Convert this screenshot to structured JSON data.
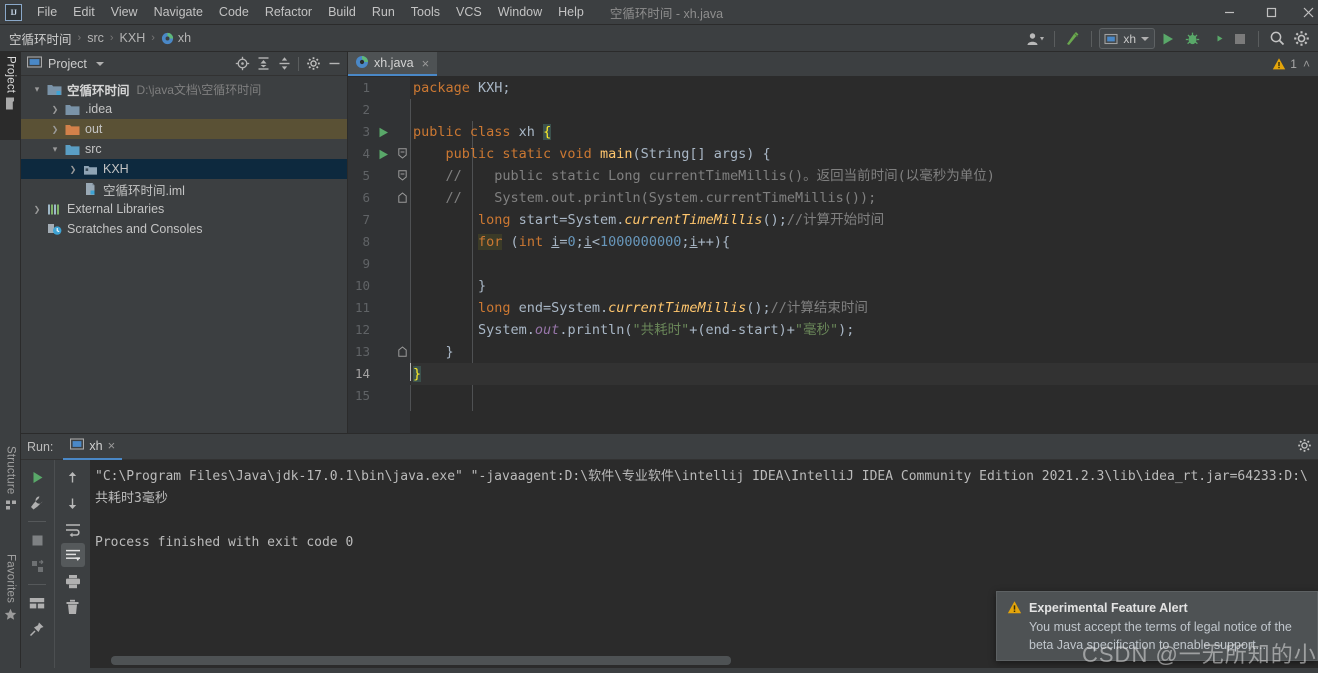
{
  "window": {
    "title": "空循环时间 - xh.java",
    "logo_text": "IJ",
    "controls": {
      "minimize": "minimize-icon",
      "maximize": "maximize-icon",
      "close": "close-icon"
    }
  },
  "menubar": {
    "items": [
      "File",
      "Edit",
      "View",
      "Navigate",
      "Code",
      "Refactor",
      "Build",
      "Run",
      "Tools",
      "VCS",
      "Window",
      "Help"
    ]
  },
  "navbar": {
    "breadcrumbs": [
      "空循环时间",
      "src",
      "KXH",
      "xh"
    ],
    "separator": "›",
    "toolbar": {
      "user_icon": "user-avatar-icon",
      "build_icon": "build-hammer-icon",
      "run_config": "xh",
      "run_icon": "run-play-icon",
      "debug_icon": "debug-bug-icon",
      "coverage_icon": "run-with-coverage-icon",
      "stop_icon": "stop-square-icon",
      "search_icon": "search-icon",
      "settings_icon": "gear-icon"
    }
  },
  "tool_tabs": {
    "left_top": "Project",
    "left_bottom": [
      "Structure",
      "Favorites"
    ]
  },
  "project_panel": {
    "title": "Project",
    "header_icons": [
      "select-opened-file-icon",
      "expand-all-icon",
      "collapse-all-icon",
      "gear-icon",
      "hide-icon"
    ],
    "tree": [
      {
        "label": "空循环时间",
        "path": "D:\\java文档\\空循环时间",
        "arrow": "⌄",
        "icon": "module-folder-icon",
        "indent": 0,
        "state": "none",
        "bold": true
      },
      {
        "label": ".idea",
        "path": "",
        "arrow": "›",
        "icon": "folder-icon",
        "indent": 1,
        "state": "none",
        "bold": false
      },
      {
        "label": "out",
        "path": "",
        "arrow": "›",
        "icon": "folder-orange-icon",
        "indent": 1,
        "state": "highlight",
        "bold": false
      },
      {
        "label": "src",
        "path": "",
        "arrow": "⌄",
        "icon": "source-folder-icon",
        "indent": 1,
        "state": "none",
        "bold": false
      },
      {
        "label": "KXH",
        "path": "",
        "arrow": "›",
        "icon": "package-icon",
        "indent": 2,
        "state": "selected",
        "bold": false
      },
      {
        "label": "空循环时间.iml",
        "path": "",
        "arrow": "",
        "icon": "iml-file-icon",
        "indent": 2,
        "state": "none",
        "bold": false
      },
      {
        "label": "External Libraries",
        "path": "",
        "arrow": "›",
        "icon": "libraries-icon",
        "indent": 0,
        "state": "none",
        "bold": false
      },
      {
        "label": "Scratches and Consoles",
        "path": "",
        "arrow": "",
        "icon": "scratches-icon",
        "indent": 0,
        "state": "none",
        "bold": false
      }
    ]
  },
  "editor": {
    "tab": {
      "label": "xh.java",
      "icon": "java-class-icon",
      "close": "×"
    },
    "warnings": {
      "icon": "warning-triangle-icon",
      "count": "1",
      "chevron": "˄"
    },
    "current_line": 14,
    "run_gutter_lines": [
      3,
      4
    ],
    "lines": [
      {
        "n": 1,
        "tokens": [
          {
            "t": "package ",
            "c": "kw"
          },
          {
            "t": "KXH;",
            "c": "pl"
          }
        ]
      },
      {
        "n": 2,
        "tokens": []
      },
      {
        "n": 3,
        "tokens": [
          {
            "t": "public class ",
            "c": "kw"
          },
          {
            "t": "xh ",
            "c": "pl"
          },
          {
            "t": "{",
            "c": "brace-hl"
          }
        ]
      },
      {
        "n": 4,
        "tokens": [
          {
            "t": "    ",
            "c": "pl"
          },
          {
            "t": "public static void ",
            "c": "kw"
          },
          {
            "t": "main",
            "c": "fn"
          },
          {
            "t": "(String[] args) {",
            "c": "pl"
          }
        ]
      },
      {
        "n": 5,
        "tokens": [
          {
            "t": "    ",
            "c": "pl"
          },
          {
            "t": "//    public static Long currentTimeMillis()。返回当前时间(以毫秒为单位)",
            "c": "cmt"
          }
        ]
      },
      {
        "n": 6,
        "tokens": [
          {
            "t": "    ",
            "c": "pl"
          },
          {
            "t": "//    System.out.println(System.currentTimeMillis());",
            "c": "cmt"
          }
        ]
      },
      {
        "n": 7,
        "tokens": [
          {
            "t": "        ",
            "c": "pl"
          },
          {
            "t": "long ",
            "c": "kw"
          },
          {
            "t": "start=System.",
            "c": "pl"
          },
          {
            "t": "currentTimeMillis",
            "c": "fni"
          },
          {
            "t": "();",
            "c": "pl"
          },
          {
            "t": "//计算开始时间",
            "c": "cmt"
          }
        ]
      },
      {
        "n": 8,
        "tokens": [
          {
            "t": "        ",
            "c": "pl"
          },
          {
            "t": "for",
            "c": "kwb"
          },
          {
            "t": " (",
            "c": "pl"
          },
          {
            "t": "int ",
            "c": "kw"
          },
          {
            "t": "i",
            "c": "ulv"
          },
          {
            "t": "=",
            "c": "pl"
          },
          {
            "t": "0",
            "c": "num"
          },
          {
            "t": ";",
            "c": "pl"
          },
          {
            "t": "i",
            "c": "ulv"
          },
          {
            "t": "<",
            "c": "pl"
          },
          {
            "t": "1000000000",
            "c": "num"
          },
          {
            "t": ";",
            "c": "pl"
          },
          {
            "t": "i",
            "c": "ulv"
          },
          {
            "t": "++){",
            "c": "pl"
          }
        ]
      },
      {
        "n": 9,
        "tokens": []
      },
      {
        "n": 10,
        "tokens": [
          {
            "t": "        }",
            "c": "pl"
          }
        ]
      },
      {
        "n": 11,
        "tokens": [
          {
            "t": "        ",
            "c": "pl"
          },
          {
            "t": "long ",
            "c": "kw"
          },
          {
            "t": "end=System.",
            "c": "pl"
          },
          {
            "t": "currentTimeMillis",
            "c": "fni"
          },
          {
            "t": "();",
            "c": "pl"
          },
          {
            "t": "//计算结束时间",
            "c": "cmt"
          }
        ]
      },
      {
        "n": 12,
        "tokens": [
          {
            "t": "        System.",
            "c": "pl"
          },
          {
            "t": "out",
            "c": "fld"
          },
          {
            "t": ".println(",
            "c": "pl"
          },
          {
            "t": "\"共耗时\"",
            "c": "str"
          },
          {
            "t": "+(end-start)+",
            "c": "pl"
          },
          {
            "t": "\"毫秒\"",
            "c": "str"
          },
          {
            "t": ");",
            "c": "pl"
          }
        ]
      },
      {
        "n": 13,
        "tokens": [
          {
            "t": "    }",
            "c": "pl"
          }
        ]
      },
      {
        "n": 14,
        "tokens": [
          {
            "t": "}",
            "c": "brace-hl"
          }
        ]
      },
      {
        "n": 15,
        "tokens": []
      }
    ]
  },
  "run_panel": {
    "label": "Run:",
    "tab": {
      "label": "xh",
      "icon": "run-config-icon",
      "close": "×"
    },
    "gear_icon": "gear-icon",
    "toolbar_left": [
      "rerun-icon",
      "wrench-icon",
      "stop-icon",
      "rerun-failed-tests-icon",
      "layout-icon",
      "pin-icon"
    ],
    "toolbar_right": [
      "up-arrow-icon",
      "down-arrow-icon",
      "soft-wrap-icon",
      "scroll-to-end-icon",
      "print-icon",
      "trash-icon"
    ],
    "output": [
      "\"C:\\Program Files\\Java\\jdk-17.0.1\\bin\\java.exe\" \"-javaagent:D:\\软件\\专业软件\\intellij IDEA\\IntelliJ IDEA Community Edition 2021.2.3\\lib\\idea_rt.jar=64233:D:\\",
      "共耗时3毫秒",
      "",
      "Process finished with exit code 0"
    ]
  },
  "notification": {
    "icon": "warning-triangle-icon",
    "title": "Experimental Feature Alert",
    "body": "You must accept the terms of legal notice of the beta Java specification to enable support..."
  },
  "watermark": "CSDN @一无所知的小白",
  "colors": {
    "accent": "#4a88c7",
    "selection": "#0d293e",
    "highlight": "#5a5135",
    "warning": "#e5a50a",
    "run_green": "#59a869",
    "panel_bg": "#3c3f41",
    "editor_bg": "#2b2b2b"
  }
}
